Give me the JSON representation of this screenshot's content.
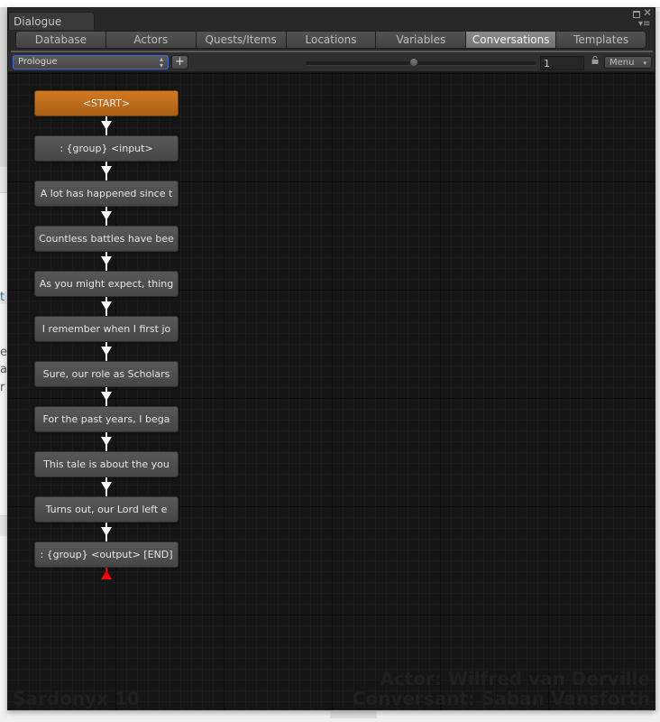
{
  "window": {
    "title": "Dialogue",
    "controls": {
      "maximize_icon": "maximize-icon",
      "close_icon": "close-icon",
      "close_glyph": "✕",
      "menu_glyph": "▾≡"
    }
  },
  "tabs": [
    {
      "label": "Database",
      "active": false
    },
    {
      "label": "Actors",
      "active": false
    },
    {
      "label": "Quests/Items",
      "active": false
    },
    {
      "label": "Locations",
      "active": false
    },
    {
      "label": "Variables",
      "active": false
    },
    {
      "label": "Conversations",
      "active": true
    },
    {
      "label": "Templates",
      "active": false
    }
  ],
  "toolbar": {
    "conversation_select": "Prologue",
    "select_arrow": "⇕",
    "add_label": "+",
    "zoom_slider_fraction": 0.47,
    "number_field": "1",
    "lock_icon": "lock-icon",
    "menu_label": "Menu",
    "menu_arrow": "▾"
  },
  "canvas": {
    "nodes": [
      {
        "text": "<START>",
        "type": "start"
      },
      {
        "text": ": {group} <input>",
        "type": "group"
      },
      {
        "text": "A lot has happened since t",
        "type": "entry"
      },
      {
        "text": "Countless battles have bee",
        "type": "entry"
      },
      {
        "text": "As you might expect, thing",
        "type": "entry"
      },
      {
        "text": "I remember when I first jo",
        "type": "entry"
      },
      {
        "text": "Sure, our role as Scholars",
        "type": "entry"
      },
      {
        "text": "For the past years, I bega",
        "type": "entry"
      },
      {
        "text": "This tale is about the you",
        "type": "entry"
      },
      {
        "text": "Turns out, our Lord left e",
        "type": "entry"
      },
      {
        "text": ": {group} <output> [END]",
        "type": "group"
      }
    ],
    "link_color": "#ffffff",
    "end_marker_color": "#ff0000",
    "start_color": "#c56f1d",
    "watermark_left": "Sardonyx 10",
    "watermark_actor": "Actor: Wilfred van Derville",
    "watermark_conversant": "Conversant: Saban Vansforth"
  },
  "background_page": {
    "fragments": [
      "t",
      "e",
      "al",
      "r"
    ]
  }
}
